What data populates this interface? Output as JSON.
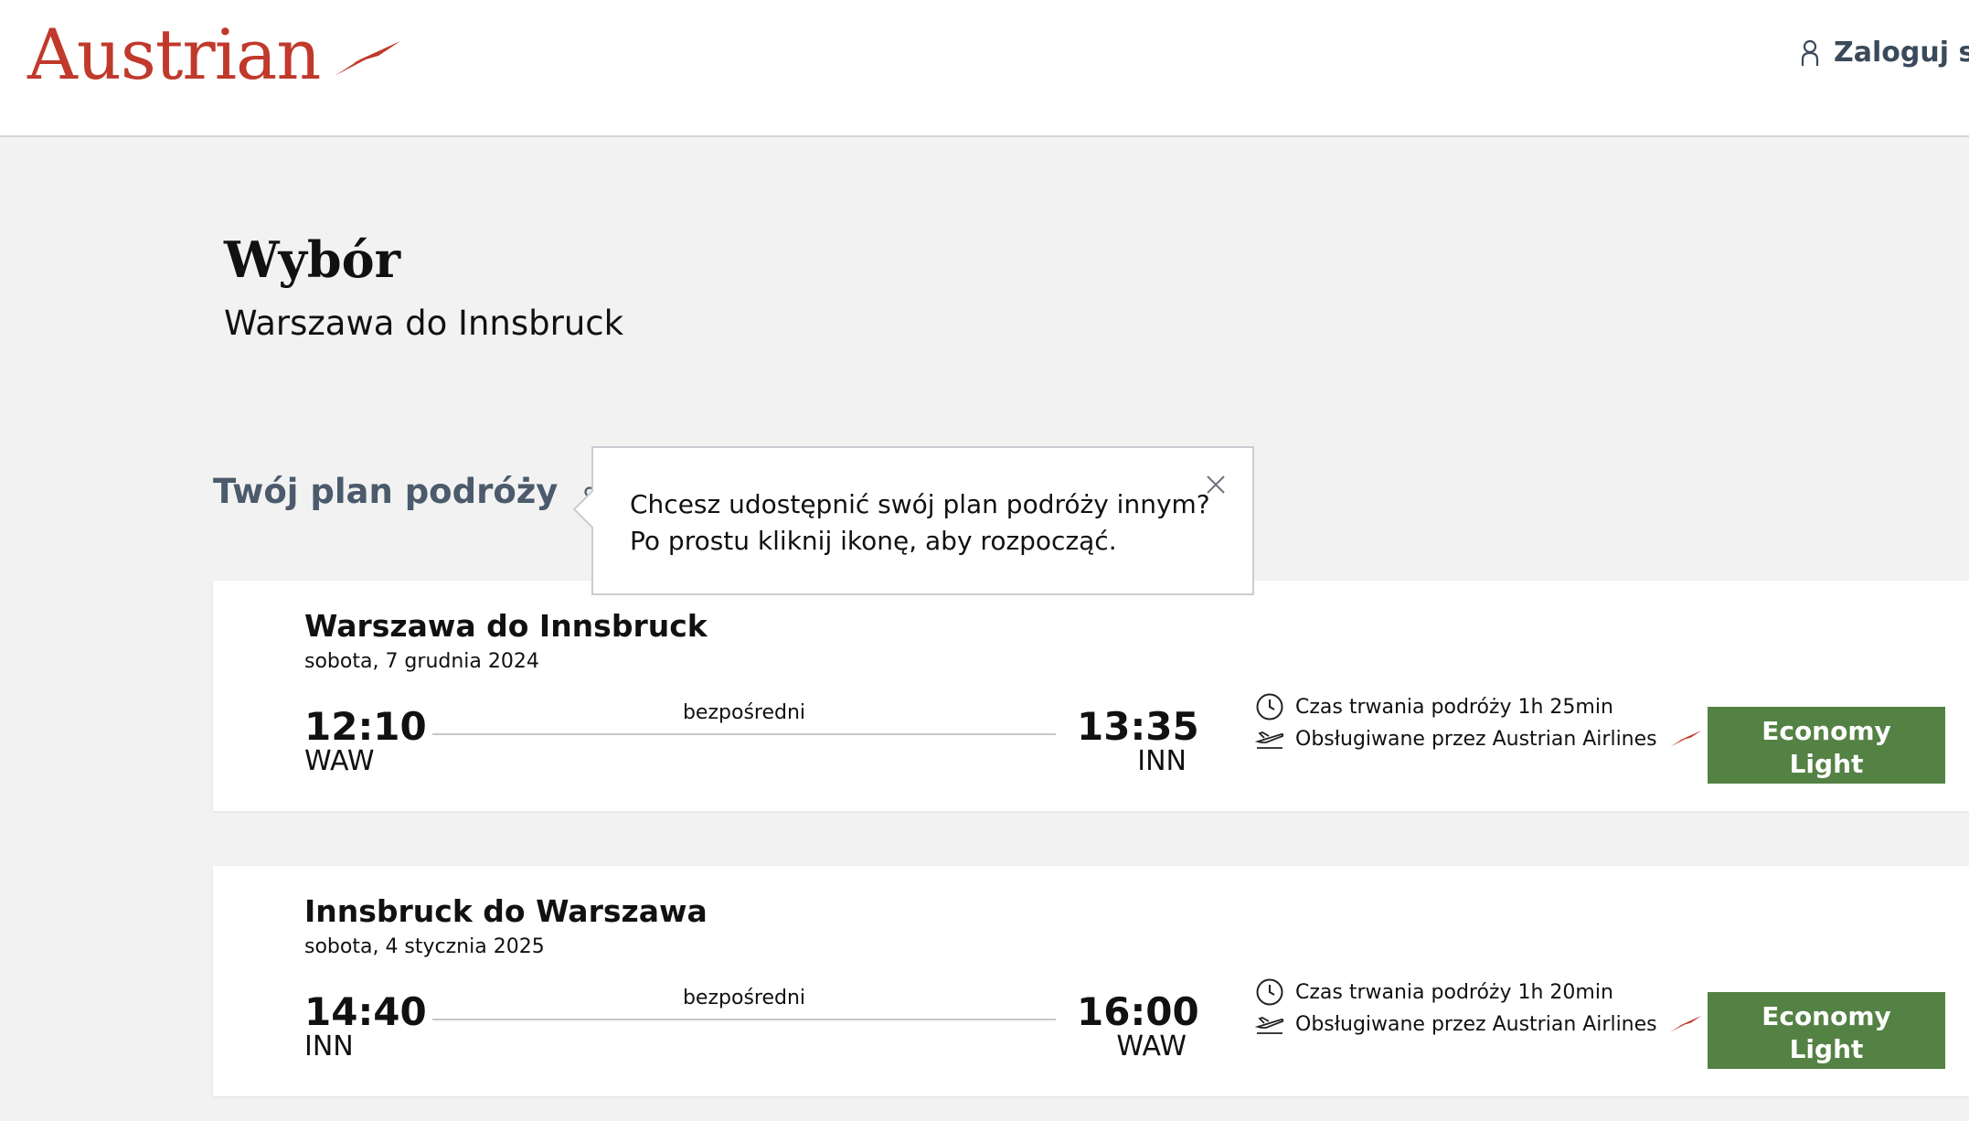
{
  "header": {
    "logo_text": "Austrian",
    "login_label": "Zaloguj się"
  },
  "page": {
    "title": "Wybór",
    "subtitle": "Warszawa do Innsbruck"
  },
  "plan": {
    "title": "Twój plan podróży"
  },
  "tooltip": {
    "line1": "Chcesz udostępnić swój plan podróży innym?",
    "line2": "Po prostu kliknij ikonę, aby rozpocząć."
  },
  "flights": [
    {
      "route": "Warszawa do Innsbruck",
      "date": "sobota, 7 grudnia 2024",
      "departure_time": "12:10",
      "departure_code": "WAW",
      "stops": "bezpośredni",
      "arrival_time": "13:35",
      "arrival_code": "INN",
      "duration": "Czas trwania podróży 1h 25min",
      "operated_by": "Obsługiwane przez Austrian Airlines",
      "fare_line1": "Economy",
      "fare_line2": "Light"
    },
    {
      "route": "Innsbruck do Warszawa",
      "date": "sobota, 4 stycznia 2025",
      "departure_time": "14:40",
      "departure_code": "INN",
      "stops": "bezpośredni",
      "arrival_time": "16:00",
      "arrival_code": "WAW",
      "duration": "Czas trwania podróży 1h 20min",
      "operated_by": "Obsługiwane przez Austrian Airlines",
      "fare_line1": "Economy",
      "fare_line2": "Light"
    }
  ],
  "colors": {
    "brand_red": "#c0392b",
    "fare_green": "#548144",
    "slate": "#4b5b6c"
  },
  "icons": {
    "logo": "austrian-wing-icon",
    "login": "user-icon",
    "share": "share-icon",
    "close": "close-icon",
    "duration": "clock-icon",
    "operator": "plane-icon"
  }
}
